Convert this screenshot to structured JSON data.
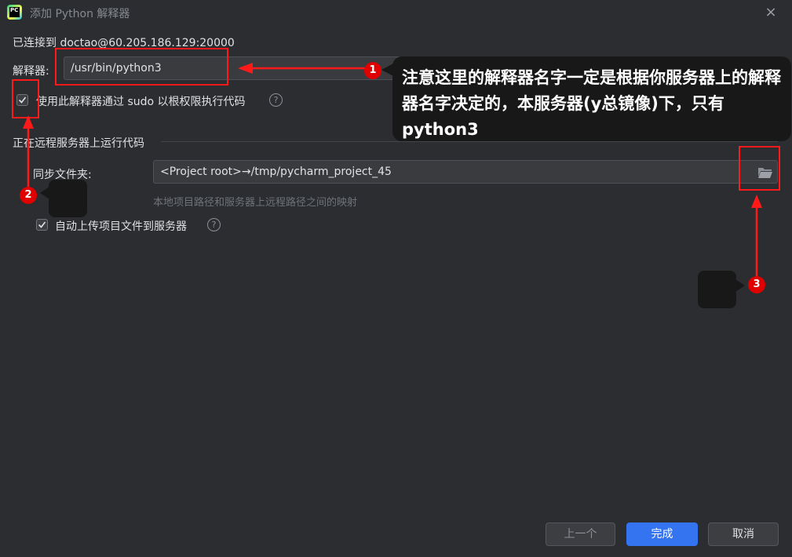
{
  "window": {
    "title": "添加 Python 解释器",
    "close_icon": "×"
  },
  "connection": {
    "text": "已连接到 doctao@60.205.186.129:20000"
  },
  "interpreter": {
    "label": "解释器:",
    "value": "/usr/bin/python3"
  },
  "sudo_option": {
    "checked": true,
    "label": "使用此解释器通过 sudo 以根权限执行代码"
  },
  "section": {
    "title": "正在远程服务器上运行代码"
  },
  "sync": {
    "label": "同步文件夹:",
    "value": "<Project root>→/tmp/pycharm_project_45",
    "hint": "本地项目路径和服务器上远程路径之间的映射"
  },
  "auto_upload": {
    "checked": true,
    "label": "自动上传项目文件到服务器"
  },
  "help_icon": "?",
  "buttons": {
    "prev": "上一个",
    "finish": "完成",
    "cancel": "取消"
  },
  "annotation": {
    "note": "注意这里的解释器名字一定是根据你服务器上的解释器名字决定的，本服务器(y总镜像)下，只有python3",
    "badges": [
      "1",
      "2",
      "3"
    ]
  },
  "colors": {
    "background": "#2b2d30",
    "accent": "#3574f0",
    "annotation_red": "#ff1a1a"
  }
}
